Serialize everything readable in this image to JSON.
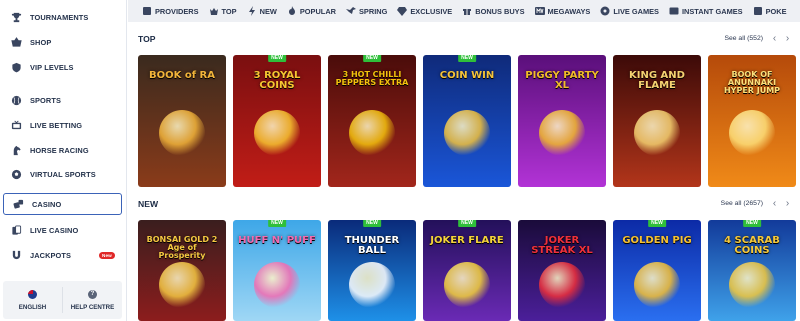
{
  "sidebar": {
    "items": [
      {
        "label": "TOURNAMENTS",
        "icon": "trophy-icon"
      },
      {
        "label": "SHOP",
        "icon": "basket-icon"
      },
      {
        "label": "VIP LEVELS",
        "icon": "shield-icon"
      },
      {
        "label": "SPORTS",
        "icon": "baseball-icon"
      },
      {
        "label": "LIVE BETTING",
        "icon": "live-tv-icon"
      },
      {
        "label": "HORSE RACING",
        "icon": "horse-icon"
      },
      {
        "label": "VIRTUAL SPORTS",
        "icon": "soccer-ball-icon"
      },
      {
        "label": "CASINO",
        "icon": "dice-icon"
      },
      {
        "label": "LIVE CASINO",
        "icon": "cards-icon"
      },
      {
        "label": "JACKPOTS",
        "icon": "magnet-icon",
        "badge": "New"
      }
    ],
    "language": "ENGLISH",
    "help": "HELP CENTRE"
  },
  "categories": [
    {
      "label": "PROVIDERS",
      "icon": "providers-icon"
    },
    {
      "label": "TOP",
      "icon": "crown-icon"
    },
    {
      "label": "NEW",
      "icon": "lightning-icon"
    },
    {
      "label": "POPULAR",
      "icon": "flame-icon"
    },
    {
      "label": "SPRING",
      "icon": "bird-icon"
    },
    {
      "label": "EXCLUSIVE",
      "icon": "diamond-icon"
    },
    {
      "label": "BONUS BUYS",
      "icon": "gift-icon"
    },
    {
      "label": "MEGAWAYS",
      "icon": "megaways-icon"
    },
    {
      "label": "LIVE GAMES",
      "icon": "roulette-icon"
    },
    {
      "label": "INSTANT GAMES",
      "icon": "instant-icon"
    },
    {
      "label": "POKE",
      "icon": "poker-icon"
    }
  ],
  "sections": {
    "top": {
      "title": "TOP",
      "see_all": "See all (552)",
      "games": [
        {
          "name": "BOOK of RA",
          "new": false,
          "bg1": "#3a2a1e",
          "bg2": "#8a3b1a",
          "accent": "#f2b43a"
        },
        {
          "name": "3 ROYAL COINS",
          "new": true,
          "bg1": "#7a0f10",
          "bg2": "#c11d17",
          "accent": "#f7c531"
        },
        {
          "name": "3 HOT CHILLI PEPPERS EXTRA",
          "new": true,
          "bg1": "#4a0c0a",
          "bg2": "#a2261b",
          "accent": "#f4c20d"
        },
        {
          "name": "COIN WIN",
          "new": true,
          "bg1": "#0f2a7a",
          "bg2": "#1a56d8",
          "accent": "#f4c33a"
        },
        {
          "name": "PIGGY PARTY XL",
          "new": false,
          "bg1": "#5a0f7a",
          "bg2": "#b233d6",
          "accent": "#f2bb2a"
        },
        {
          "name": "KING AND FLAME",
          "new": false,
          "bg1": "#3c0a08",
          "bg2": "#b2351a",
          "accent": "#f5d271"
        },
        {
          "name": "BOOK OF ANUNNAKI HYPER JUMP",
          "new": false,
          "bg1": "#b54a0a",
          "bg2": "#f08a18",
          "accent": "#fde07a"
        }
      ]
    },
    "new": {
      "title": "NEW",
      "see_all": "See all (2657)",
      "games": [
        {
          "name": "BONSAI GOLD 2 Age of Prosperity",
          "new": false,
          "bg1": "#3a1e1e",
          "bg2": "#8c1d1d",
          "accent": "#f5c842"
        },
        {
          "name": "HUFF N' PUFF",
          "new": true,
          "bg1": "#3ea7e8",
          "bg2": "#9fd7f5",
          "accent": "#f46ab0"
        },
        {
          "name": "THUNDER BALL",
          "new": true,
          "bg1": "#0a2a7a",
          "bg2": "#1e90e8",
          "accent": "#ffffff"
        },
        {
          "name": "JOKER FLARE",
          "new": true,
          "bg1": "#23105a",
          "bg2": "#6a2ab5",
          "accent": "#f5d33a"
        },
        {
          "name": "JOKER STREAK XL",
          "new": false,
          "bg1": "#1a0b3a",
          "bg2": "#4b1f9a",
          "accent": "#f0303a"
        },
        {
          "name": "GOLDEN PIG",
          "new": true,
          "bg1": "#0c2aa6",
          "bg2": "#2a6ff0",
          "accent": "#f7c131"
        },
        {
          "name": "4 SCARAB COINS",
          "new": true,
          "bg1": "#123a9a",
          "bg2": "#3fa2ea",
          "accent": "#f5c93a"
        }
      ]
    }
  },
  "labels": {
    "new_tag": "NEW",
    "prev": "‹",
    "next": "›"
  }
}
